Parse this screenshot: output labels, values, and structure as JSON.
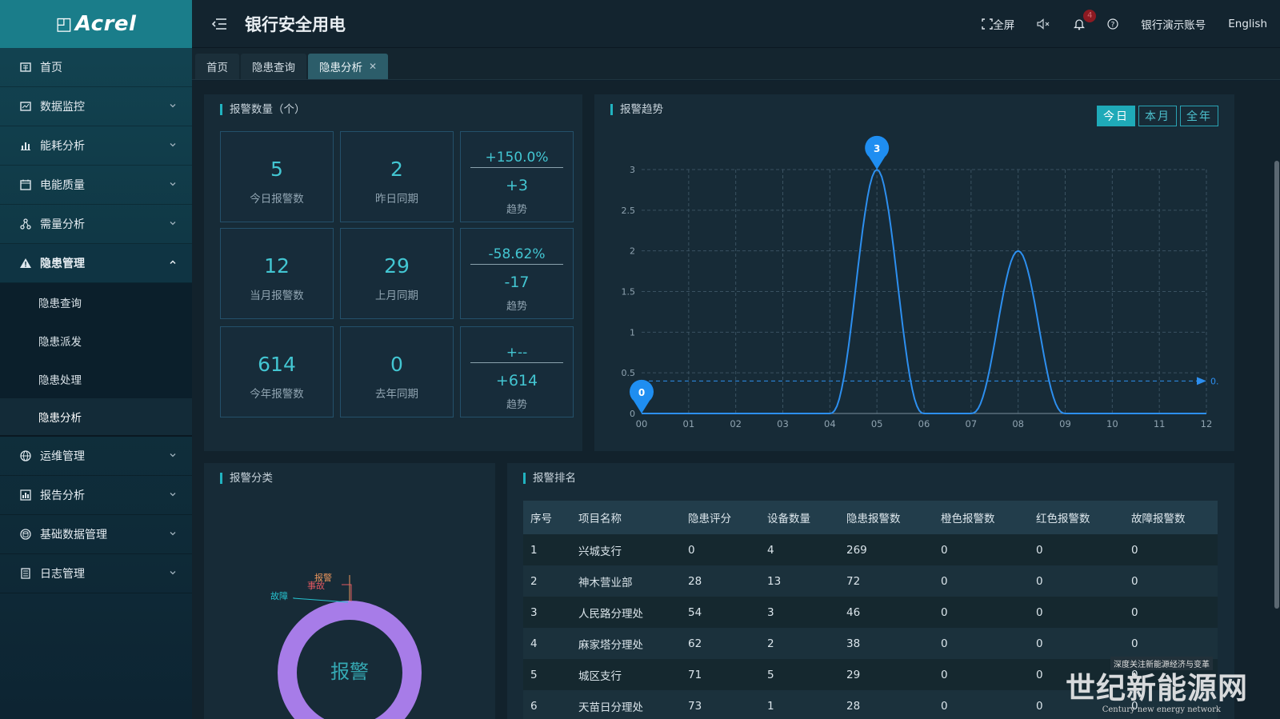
{
  "app": {
    "logo": "Acrel",
    "title": "银行安全用电"
  },
  "header": {
    "fullscreen": "全屏",
    "notification_count": "4",
    "account": "银行演示账号",
    "language": "English"
  },
  "sidebar": {
    "items": [
      {
        "label": "首页",
        "icon": "home-icon"
      },
      {
        "label": "数据监控",
        "icon": "monitor-icon"
      },
      {
        "label": "能耗分析",
        "icon": "bar-chart-icon"
      },
      {
        "label": "电能质量",
        "icon": "calendar-icon"
      },
      {
        "label": "需量分析",
        "icon": "network-icon"
      },
      {
        "label": "隐患管理",
        "icon": "warning-icon"
      },
      {
        "label": "运维管理",
        "icon": "globe-icon"
      },
      {
        "label": "报告分析",
        "icon": "report-icon"
      },
      {
        "label": "基础数据管理",
        "icon": "database-icon"
      },
      {
        "label": "日志管理",
        "icon": "log-icon"
      }
    ],
    "submenu": [
      "隐患查询",
      "隐患派发",
      "隐患处理",
      "隐患分析"
    ]
  },
  "tabs": [
    {
      "label": "首页"
    },
    {
      "label": "隐患查询"
    },
    {
      "label": "隐患分析"
    }
  ],
  "alarm_count": {
    "title": "报警数量（个）",
    "rows": [
      {
        "current": "5",
        "current_label": "今日报警数",
        "prev": "2",
        "prev_label": "昨日同期",
        "pct": "+150.0%",
        "diff": "+3",
        "trend_label": "趋势"
      },
      {
        "current": "12",
        "current_label": "当月报警数",
        "prev": "29",
        "prev_label": "上月同期",
        "pct": "-58.62%",
        "diff": "-17",
        "trend_label": "趋势"
      },
      {
        "current": "614",
        "current_label": "今年报警数",
        "prev": "0",
        "prev_label": "去年同期",
        "pct": "+--",
        "diff": "+614",
        "trend_label": "趋势"
      }
    ]
  },
  "trend": {
    "title": "报警趋势",
    "ranges": [
      "今日",
      "本月",
      "全年"
    ],
    "avg_label": "0."
  },
  "chart_data": {
    "type": "line",
    "x": [
      "00",
      "01",
      "02",
      "03",
      "04",
      "05",
      "06",
      "07",
      "08",
      "09",
      "10",
      "11",
      "12"
    ],
    "series": [
      {
        "values": [
          0,
          0,
          0,
          0,
          0,
          3,
          0,
          0,
          2,
          0,
          0,
          0,
          0
        ]
      }
    ],
    "ylim": [
      0,
      3
    ],
    "yticks": [
      "0",
      "0.5",
      "1",
      "1.5",
      "2",
      "2.5",
      "3"
    ],
    "markers": [
      {
        "label": "3",
        "x": "05",
        "y": 3
      },
      {
        "label": "0",
        "x": "00",
        "y": 0
      }
    ],
    "average_line": 0.4,
    "grid": true,
    "smooth": true,
    "color": "#2d8fef"
  },
  "category": {
    "title": "报警分类",
    "center_label": "报警",
    "labels": {
      "alarm": "报警",
      "accident": "事故",
      "fault": "故障"
    },
    "colors": {
      "ring": "#a77ce8",
      "alarm": "#e8945c",
      "accident": "#e05860",
      "fault": "#27c3d0"
    }
  },
  "ranking": {
    "title": "报警排名",
    "columns": [
      "序号",
      "项目名称",
      "隐患评分",
      "设备数量",
      "隐患报警数",
      "橙色报警数",
      "红色报警数",
      "故障报警数"
    ],
    "rows": [
      [
        "1",
        "兴城支行",
        "0",
        "4",
        "269",
        "0",
        "0",
        "0"
      ],
      [
        "2",
        "神木营业部",
        "28",
        "13",
        "72",
        "0",
        "0",
        "0"
      ],
      [
        "3",
        "人民路分理处",
        "54",
        "3",
        "46",
        "0",
        "0",
        "0"
      ],
      [
        "4",
        "麻家塔分理处",
        "62",
        "2",
        "38",
        "0",
        "0",
        "0"
      ],
      [
        "5",
        "城区支行",
        "71",
        "5",
        "29",
        "0",
        "0",
        "0"
      ],
      [
        "6",
        "天苗日分理处",
        "73",
        "1",
        "28",
        "0",
        "0",
        "0"
      ]
    ]
  },
  "watermark": {
    "tag": "深度关注新能源经济与变革",
    "main": "世纪新能源网",
    "sub": "Century new energy network"
  }
}
